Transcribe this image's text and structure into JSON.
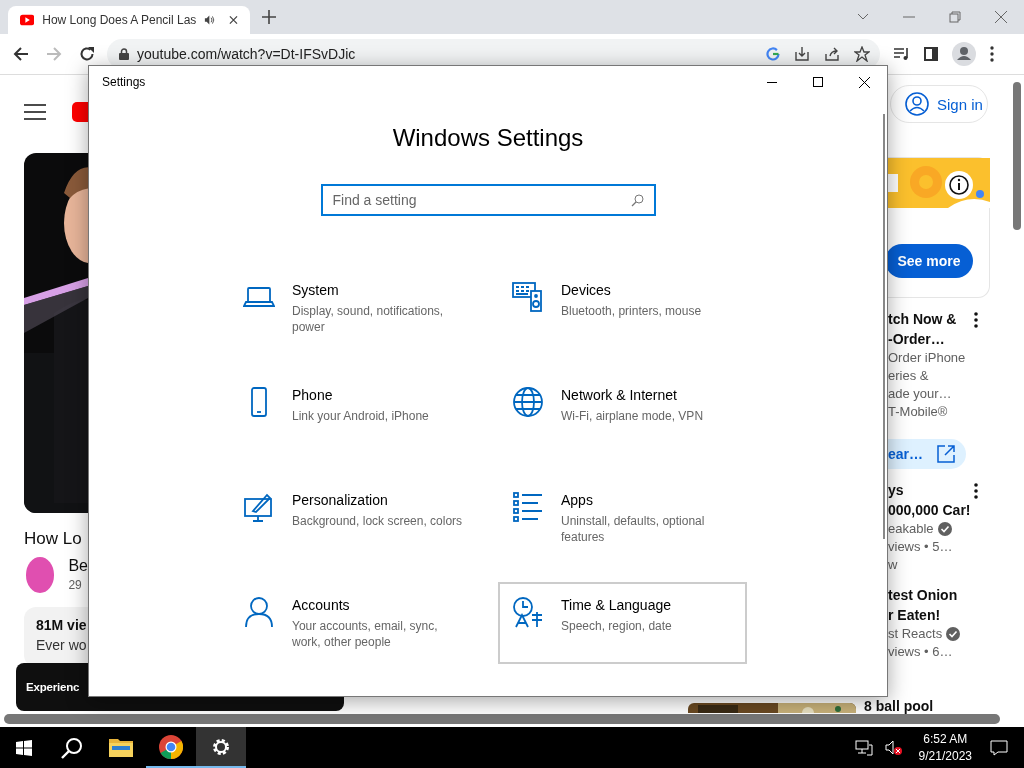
{
  "browser": {
    "tab": {
      "title": "How Long Does A Pencil Las"
    },
    "toolbar": {
      "forward_disabled": true,
      "url": "youtube.com/watch?v=Dt-IFSvDJic"
    }
  },
  "youtube": {
    "sign_in": "Sign in",
    "video_title": "How Lo",
    "channel": "Be",
    "subscribers": "29",
    "views": "81M vie",
    "description": "Ever wo",
    "toast": "Experienc",
    "ad": {
      "button": "See more"
    },
    "recommendations": [
      {
        "title_lines": [
          "tch Now &",
          "-Order…"
        ],
        "lines": [
          "Order iPhone",
          "eries &",
          "ade your…"
        ],
        "channel": "T-Mobile®",
        "verified": false,
        "cta": "ear…",
        "menu_visible": true
      },
      {
        "title_lines": [
          "ys",
          "000,000 Car!"
        ],
        "channel": "eakable",
        "verified": true,
        "meta": [
          "views • 5…",
          "w"
        ],
        "menu_visible": true
      },
      {
        "title_lines": [
          "test Onion",
          "r Eaten!"
        ],
        "channel": "st Reacts",
        "verified": true,
        "meta": [
          "views • 6…"
        ],
        "menu_visible": false
      }
    ],
    "last_title": "8 ball pool"
  },
  "settings_window": {
    "title": "Settings",
    "heading": "Windows Settings",
    "search": {
      "placeholder": "Find a setting"
    },
    "categories": [
      {
        "name": "System",
        "description": "Display, sound, notifications, power",
        "hovered": false
      },
      {
        "name": "Devices",
        "description": "Bluetooth, printers, mouse",
        "hovered": false
      },
      {
        "name": "Phone",
        "description": "Link your Android, iPhone",
        "hovered": false
      },
      {
        "name": "Network & Internet",
        "description": "Wi-Fi, airplane mode, VPN",
        "hovered": false
      },
      {
        "name": "Personalization",
        "description": "Background, lock screen, colors",
        "hovered": false
      },
      {
        "name": "Apps",
        "description": "Uninstall, defaults, optional features",
        "hovered": false
      },
      {
        "name": "Accounts",
        "description": "Your accounts, email, sync, work, other people",
        "hovered": false
      },
      {
        "name": "Time & Language",
        "description": "Speech, region, date",
        "hovered": true
      }
    ]
  },
  "taskbar": {
    "apps": [
      {
        "running": false,
        "active": false
      },
      {
        "running": true,
        "active": false
      },
      {
        "running": true,
        "active": true
      }
    ],
    "time": "6:52 AM",
    "date": "9/21/2023"
  }
}
